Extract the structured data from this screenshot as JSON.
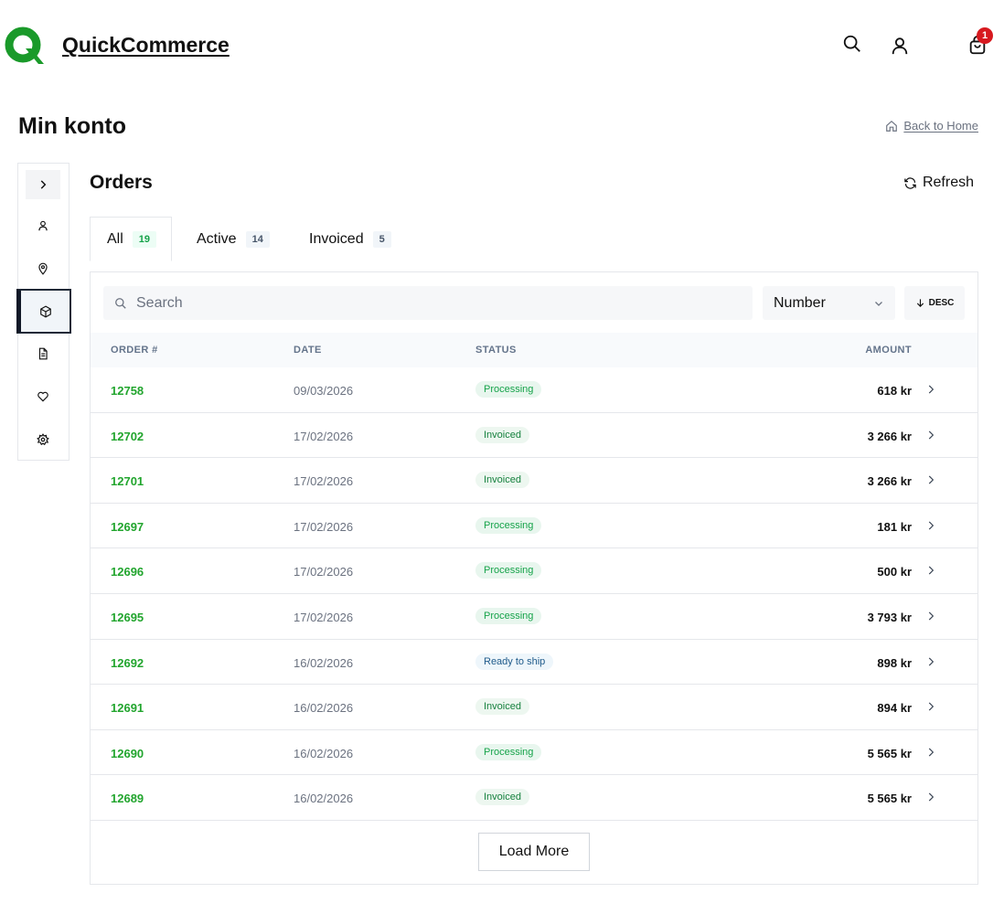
{
  "header": {
    "brand": "QuickCommerce",
    "brand_color": "#1a9a2a",
    "cart_count": "1",
    "icons": [
      "search-icon",
      "user-icon",
      "cart-icon"
    ]
  },
  "page": {
    "title": "Min konto",
    "back_link": "Back to Home"
  },
  "sidenav": {
    "items": [
      "chevron-right-icon",
      "user-icon",
      "map-pin-icon",
      "package-icon",
      "document-icon",
      "heart-icon",
      "gear-icon"
    ],
    "active": "package-icon"
  },
  "orders": {
    "title": "Orders",
    "refresh_label": "Refresh",
    "tabs": [
      {
        "label": "All",
        "count": "19"
      },
      {
        "label": "Active",
        "count": "14"
      },
      {
        "label": "Invoiced",
        "count": "5"
      }
    ],
    "search_placeholder": "Search",
    "sort_by": "Number",
    "sort_dir": "DESC",
    "columns": [
      "ORDER #",
      "DATE",
      "STATUS",
      "AMOUNT"
    ],
    "rows": [
      {
        "number": "12758",
        "date": "09/03/2026",
        "status": "Processing",
        "amount": "618 kr"
      },
      {
        "number": "12702",
        "date": "17/02/2026",
        "status": "Invoiced",
        "amount": "3 266 kr"
      },
      {
        "number": "12701",
        "date": "17/02/2026",
        "status": "Invoiced",
        "amount": "3 266 kr"
      },
      {
        "number": "12697",
        "date": "17/02/2026",
        "status": "Processing",
        "amount": "181 kr"
      },
      {
        "number": "12696",
        "date": "17/02/2026",
        "status": "Processing",
        "amount": "500 kr"
      },
      {
        "number": "12695",
        "date": "17/02/2026",
        "status": "Processing",
        "amount": "3 793 kr"
      },
      {
        "number": "12692",
        "date": "16/02/2026",
        "status": "Ready to ship",
        "amount": "898 kr"
      },
      {
        "number": "12691",
        "date": "16/02/2026",
        "status": "Invoiced",
        "amount": "894 kr"
      },
      {
        "number": "12690",
        "date": "16/02/2026",
        "status": "Processing",
        "amount": "5 565 kr"
      },
      {
        "number": "12689",
        "date": "16/02/2026",
        "status": "Invoiced",
        "amount": "5 565 kr"
      }
    ],
    "load_more": "Load More"
  }
}
